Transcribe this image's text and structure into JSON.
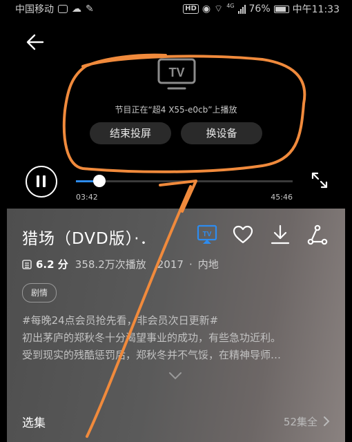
{
  "status_bar": {
    "carrier": "中国移动",
    "network": "4G",
    "battery": "76%",
    "time": "中午11:33"
  },
  "player": {
    "cast_icon_text": "TV",
    "cast_message": "节目正在“超4 X55-e0cb”上播放",
    "end_cast_label": "结束投屏",
    "switch_device_label": "换设备",
    "current_time": "03:42",
    "total_time": "45:46",
    "progress": 0.108
  },
  "details": {
    "title": "猎场（DVD版）·．",
    "cast_badge": "TV",
    "rating": "6.2 分",
    "play_count": "358.2万次播放",
    "year": "2017",
    "separator": "·",
    "region": "内地",
    "tag": "剧情",
    "description": [
      "#每晚24点会员抢先看，非会员次日更新#",
      "初出茅庐的郑秋冬十分渴望事业的成功，有些急功近利。",
      "受到现实的残酷惩罚后，郑秋冬并不气馁，在精神导师…"
    ],
    "episodes_label": "选集",
    "episodes_count": "52集全"
  },
  "colors": {
    "accent_blue": "#2d8cf0",
    "annotation_orange": "#f08a3c"
  },
  "icons": [
    "back-arrow-icon",
    "tv-icon",
    "pause-icon",
    "fullscreen-icon",
    "cast-icon",
    "heart-icon",
    "download-icon",
    "share-icon",
    "chevron-down-icon",
    "chevron-right-icon",
    "rating-icon"
  ]
}
